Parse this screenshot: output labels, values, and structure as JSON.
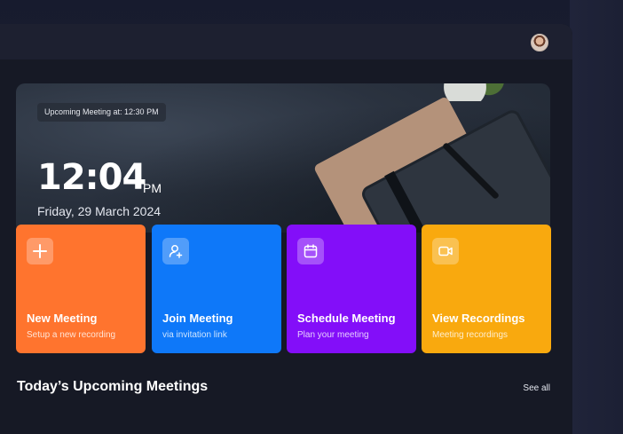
{
  "header": {
    "avatar_icon": "user-avatar"
  },
  "hero": {
    "upcoming_label": "Upcoming Meeting at: 12:30 PM",
    "time": "12:04",
    "ampm": "PM",
    "date": "Friday, 29 March 2024"
  },
  "actions": [
    {
      "title": "New Meeting",
      "subtitle": "Setup a new recording",
      "icon": "plus-icon",
      "color": "#ff742e"
    },
    {
      "title": "Join Meeting",
      "subtitle": "via invitation link",
      "icon": "user-add-icon",
      "color": "#0e78f9"
    },
    {
      "title": "Schedule Meeting",
      "subtitle": "Plan your meeting",
      "icon": "calendar-icon",
      "color": "#830ef9"
    },
    {
      "title": "View Recordings",
      "subtitle": "Meeting recordings",
      "icon": "video-icon",
      "color": "#f9a90e"
    }
  ],
  "section": {
    "title": "Today’s Upcoming Meetings",
    "see_all": "See all"
  }
}
